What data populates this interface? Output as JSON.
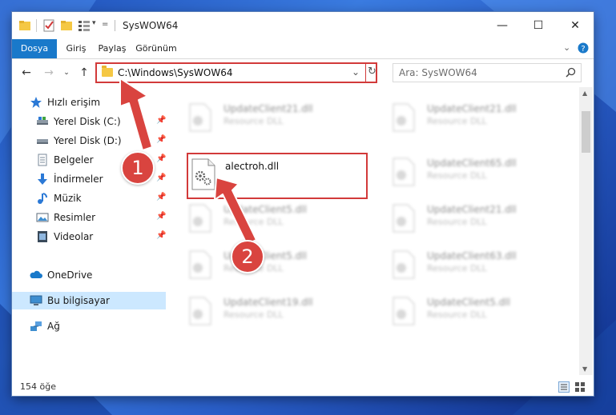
{
  "window": {
    "title": "SysWOW64",
    "minimize_glyph": "—",
    "maximize_glyph": "☐",
    "close_glyph": "✕"
  },
  "ribbon": {
    "tabs": [
      "Dosya",
      "Giriş",
      "Paylaş",
      "Görünüm"
    ],
    "accent": "#1979ca"
  },
  "address": {
    "path": "C:\\Windows\\SysWOW64"
  },
  "search": {
    "placeholder": "Ara: SysWOW64"
  },
  "nav": {
    "items": [
      {
        "label": "Hızlı erişim",
        "icon": "star-icon"
      },
      {
        "label": "Yerel Disk (C:)",
        "icon": "drive-icon"
      },
      {
        "label": "Yerel Disk (D:)",
        "icon": "drive-icon"
      },
      {
        "label": "Belgeler",
        "icon": "documents-icon"
      },
      {
        "label": "İndirmeler",
        "icon": "download-icon"
      },
      {
        "label": "Müzik",
        "icon": "music-icon"
      },
      {
        "label": "Resimler",
        "icon": "pictures-icon"
      },
      {
        "label": "Videolar",
        "icon": "videos-icon"
      },
      {
        "label": "OneDrive",
        "icon": "cloud-icon"
      },
      {
        "label": "Bu bilgisayar",
        "icon": "computer-icon"
      },
      {
        "label": "Ağ",
        "icon": "network-icon"
      }
    ]
  },
  "files": {
    "selected": {
      "name": "alectroh.dll"
    },
    "left": [
      {
        "name": "UpdateClient21.dll",
        "desc": "Resource DLL"
      },
      {
        "name": "UpdateClient5.dll",
        "desc": "Resource DLL"
      },
      {
        "name": "UpdateClient5.dll",
        "desc": "Resource DLL"
      },
      {
        "name": "UpdateClient19.dll",
        "desc": "Resource DLL"
      }
    ],
    "right": [
      {
        "name": "UpdateClient21.dll",
        "desc": "Resource DLL"
      },
      {
        "name": "UpdateClient65.dll",
        "desc": "Resource DLL"
      },
      {
        "name": "UpdateClient21.dll",
        "desc": "Resource DLL"
      },
      {
        "name": "UpdateClient63.dll",
        "desc": "Resource DLL"
      },
      {
        "name": "UpdateClient5.dll",
        "desc": "Resource DLL"
      }
    ]
  },
  "status": {
    "count": "154 öğe"
  },
  "annotations": {
    "step1": "1",
    "step2": "2",
    "color": "#d9443f"
  }
}
